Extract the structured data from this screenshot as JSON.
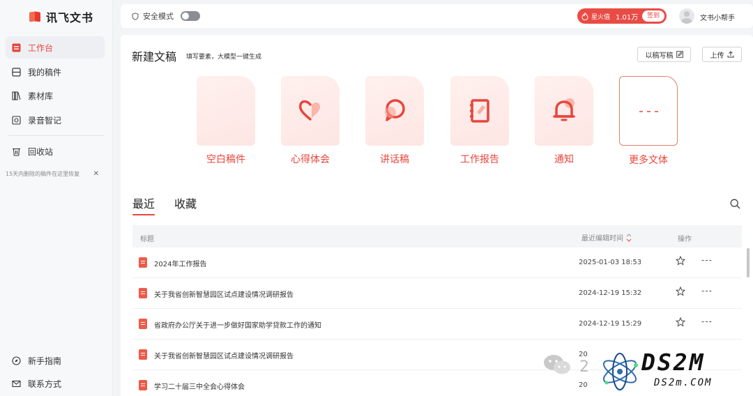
{
  "app": {
    "logo_text": "讯飞文书"
  },
  "sidebar": {
    "items": [
      {
        "label": "工作台",
        "icon": "workbench-icon",
        "active": true
      },
      {
        "label": "我的稿件",
        "icon": "drafts-icon"
      },
      {
        "label": "素材库",
        "icon": "library-icon"
      },
      {
        "label": "录音智记",
        "icon": "recording-icon"
      },
      {
        "label": "回收站",
        "icon": "trash-icon"
      }
    ],
    "recycle_note": "15天内删除的稿件在这里恢复",
    "bottom": [
      {
        "label": "新手指南",
        "icon": "compass-icon"
      },
      {
        "label": "联系方式",
        "icon": "mail-icon"
      }
    ]
  },
  "topbar": {
    "safe_mode_label": "安全模式",
    "safe_mode_on": false,
    "coins_label": "星火值",
    "coins_value": "1.01万",
    "checkin_label": "签到",
    "username": "文书小帮手"
  },
  "new_doc": {
    "title": "新建文稿",
    "subtitle": "填写要素，大模型一键生成",
    "outline_button": "以稿写稿",
    "upload_button": "上传",
    "types": [
      {
        "label": "空白稿件",
        "icon": "blank-doc-icon"
      },
      {
        "label": "心得体会",
        "icon": "heart-icon"
      },
      {
        "label": "讲话稿",
        "icon": "speech-icon"
      },
      {
        "label": "工作报告",
        "icon": "report-icon"
      },
      {
        "label": "通知",
        "icon": "bell-icon"
      },
      {
        "label": "更多文体",
        "icon": "more-icon"
      }
    ]
  },
  "tabs": {
    "recent": "最近",
    "favorites": "收藏"
  },
  "table": {
    "headers": {
      "title": "标题",
      "time": "最近编辑时间",
      "op": "操作"
    },
    "rows": [
      {
        "title": "2024年工作报告",
        "time": "2025-01-03 18:53"
      },
      {
        "title": "关于我省创新智慧园区试点建设情况调研报告",
        "time": "2024-12-19 15:32"
      },
      {
        "title": "省政府办公厅关于进一步做好国家助学贷款工作的通知",
        "time": "2024-12-19 15:29"
      },
      {
        "title": "关于我省创新智慧园区试点建设情况调研报告",
        "time": "20"
      },
      {
        "title": "学习二十届三中全会心得体会",
        "time": "20"
      }
    ]
  },
  "watermark": {
    "big": "DS2M",
    "small": "DS2m.COM",
    "zero": "2"
  },
  "colors": {
    "accent": "#e8453c",
    "coins_bg": "#e94b45"
  }
}
